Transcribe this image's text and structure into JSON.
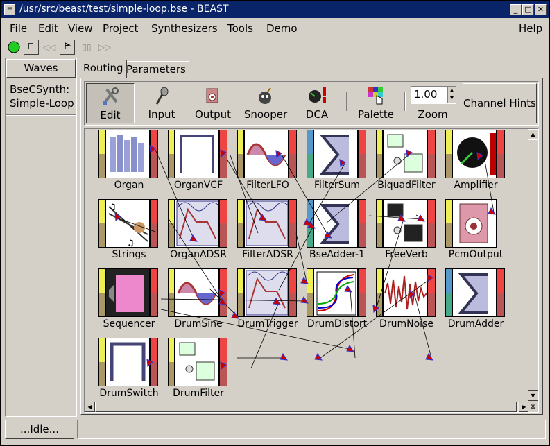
{
  "window": {
    "title": "/usr/src/beast/test/simple-loop.bse - BEAST",
    "controls": [
      "minimize",
      "maximize",
      "close"
    ]
  },
  "menubar": [
    {
      "label": "File",
      "key": "F"
    },
    {
      "label": "Edit",
      "key": "E"
    },
    {
      "label": "View",
      "key": "V"
    },
    {
      "label": "Project",
      "key": "P"
    },
    {
      "label": "Synthesizers",
      "key": "S"
    },
    {
      "label": "Tools",
      "key": "T"
    },
    {
      "label": "Demo",
      "key": "D"
    },
    {
      "label": "Help",
      "key": "H"
    }
  ],
  "transport": {
    "play_icon": "green-circle-icon",
    "stop_icon": "stop-icon",
    "rewind_icon": "rewind-icon",
    "mark_icon": "flag-icon",
    "pause_icon": "pause-icon",
    "forward_icon": "fast-forward-icon"
  },
  "sidebar": {
    "tab_label": "Waves",
    "item_line1": "BseCSynth:",
    "item_line2": "Simple-Loop"
  },
  "tabs": [
    "Routing",
    "Parameters"
  ],
  "tools": [
    "Edit",
    "Input",
    "Output",
    "Snooper",
    "DCA",
    "Palette",
    "Zoom"
  ],
  "zoom_value": "1.00",
  "channel_hints_label": "Channel Hints",
  "modules": [
    {
      "name": "Organ",
      "icon": "organ-pipes-icon"
    },
    {
      "name": "OrganVCF",
      "icon": "filter-icon"
    },
    {
      "name": "FilterLFO",
      "icon": "sine-wave-icon"
    },
    {
      "name": "FilterSum",
      "icon": "sigma-icon"
    },
    {
      "name": "BiquadFilter",
      "icon": "biquad-icon"
    },
    {
      "name": "Amplifier",
      "icon": "amplifier-icon"
    },
    {
      "name": "Strings",
      "icon": "strings-icon"
    },
    {
      "name": "OrganADSR",
      "icon": "adsr-icon"
    },
    {
      "name": "FilterADSR",
      "icon": "adsr-icon"
    },
    {
      "name": "BseAdder-1",
      "icon": "sigma-icon"
    },
    {
      "name": "FreeVerb",
      "icon": "reverb-icon"
    },
    {
      "name": "PcmOutput",
      "icon": "speaker-icon"
    },
    {
      "name": "Sequencer",
      "icon": "sequencer-icon"
    },
    {
      "name": "DrumSine",
      "icon": "sine-wave-icon"
    },
    {
      "name": "DrumTrigger",
      "icon": "adsr-icon"
    },
    {
      "name": "DrumDistort",
      "icon": "distort-icon"
    },
    {
      "name": "DrumNoise",
      "icon": "noise-icon"
    },
    {
      "name": "DrumAdder",
      "icon": "sigma-icon"
    },
    {
      "name": "DrumSwitch",
      "icon": "switch-icon"
    },
    {
      "name": "DrumFilter",
      "icon": "biquad-icon"
    }
  ],
  "status": {
    "left": "...Idle...",
    "right": ""
  }
}
